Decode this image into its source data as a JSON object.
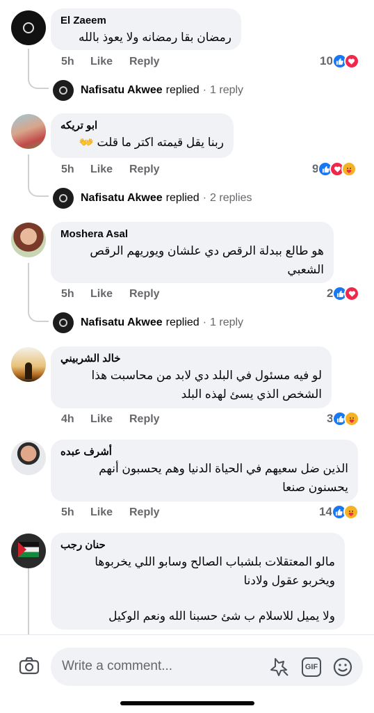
{
  "actions": {
    "like_label": "Like",
    "reply_label": "Reply"
  },
  "comments": [
    {
      "author": "El Zaeem",
      "text_lines": [
        "رمضان بقا رمضانه ولا يعوذ بالله"
      ],
      "time": "5h",
      "reaction_count": "10",
      "reactions": [
        "like-reaction-icon",
        "love-reaction-icon"
      ],
      "replies": {
        "name": "Nafisatu Akwee",
        "verb": "replied",
        "count": "1 reply"
      }
    },
    {
      "author": "ابو تريكه",
      "text_lines": [
        "ربنا يقل قيمته اكتر ما قلت 👐"
      ],
      "time": "5h",
      "reaction_count": "9",
      "reactions": [
        "like-reaction-icon",
        "love-reaction-icon",
        "care-reaction-icon"
      ],
      "replies": {
        "name": "Nafisatu Akwee",
        "verb": "replied",
        "count": "2 replies"
      }
    },
    {
      "author": "Moshera Asal",
      "text_lines": [
        "هو طالع ببدلة الرقص دي علشان ويوريهم الرقص",
        "الشعبي"
      ],
      "time": "5h",
      "reaction_count": "2",
      "reactions": [
        "like-reaction-icon",
        "love-reaction-icon"
      ],
      "replies": {
        "name": "Nafisatu Akwee",
        "verb": "replied",
        "count": "1 reply"
      }
    },
    {
      "author": "خالد الشربيني",
      "text_lines": [
        "لو فيه مسئول في البلد دي لابد من محاسبت هذا",
        "الشخص الذي يسئ لهذه البلد"
      ],
      "time": "4h",
      "reaction_count": "3",
      "reactions": [
        "like-reaction-icon",
        "care-reaction-icon"
      ]
    },
    {
      "author": "أشرف عبده",
      "text_lines": [
        "الذين ضل سعيهم في الحياة الدنيا وهم يحسبون أنهم",
        "يحسنون صنعا"
      ],
      "time": "5h",
      "reaction_count": "14",
      "reactions": [
        "like-reaction-icon",
        "care-reaction-icon"
      ]
    },
    {
      "author": "حنان رجب",
      "text_lines": [
        "مالو المعتقلات بلشباب الصالح وسابو اللي يخربوها",
        "ويخربو عقول ولادنا",
        "",
        "ولا يميل للاسلام ب شئ حسبنا الله ونعم الوكيل"
      ]
    }
  ],
  "composer": {
    "placeholder": "Write a comment...",
    "gif_label": "GIF"
  },
  "colors": {
    "like": "#1877f2",
    "love": "#f0284a",
    "care": "#f7b125",
    "secondary_text": "#65676b",
    "bubble": "#f0f2f5"
  }
}
